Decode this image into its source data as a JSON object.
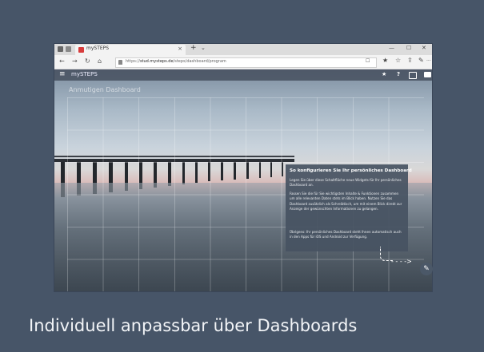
{
  "browser": {
    "tab_title": "mySTEPS",
    "tab_close": "×",
    "new_tab": "+",
    "tab_dropdown": "⌄",
    "minimize": "—",
    "maximize": "☐",
    "close": "✕",
    "back": "←",
    "forward": "→",
    "reload": "↻",
    "home": "⌂",
    "url_prefix": "https://",
    "url_host": "stud.mysteps.de",
    "url_path": "/steps/dashboard/program",
    "reading_icon": "☐",
    "favorite_icon": "★",
    "collections_icon": "☆",
    "share_icon": "⇪",
    "pen_icon": "✎",
    "more_icon": "···"
  },
  "app": {
    "menu": "≡",
    "name": "mySTEPS",
    "greeting": "Anmutigen Dashboard",
    "star": "★",
    "help": "?",
    "panel": {
      "title": "So konfigurieren Sie Ihr persönliches Dashboard",
      "p1": "Legen Sie über diese Schaltfläche neue Widgets für Ihr persönliches Dashboard an.",
      "p2": "Fassen Sie die für Sie wichtigsten Inhalte & Funktionen zusammen um alle relevanten Daten stets im Blick haben. Nutzen Sie das Dashboard zusätzlich als Schreibtisch, um mit einem Blick direkt zur Anzeige der gewünschten Informationen zu gelangen.",
      "p3": "Übrigens: Ihr persönliches Dashboard steht Ihnen automatisch auch in den Apps für iOS und Android zur Verfügung."
    },
    "arrow": "- - - ->",
    "edit_icon": "✎"
  },
  "caption": "Individuell anpassbar über Dashboards"
}
